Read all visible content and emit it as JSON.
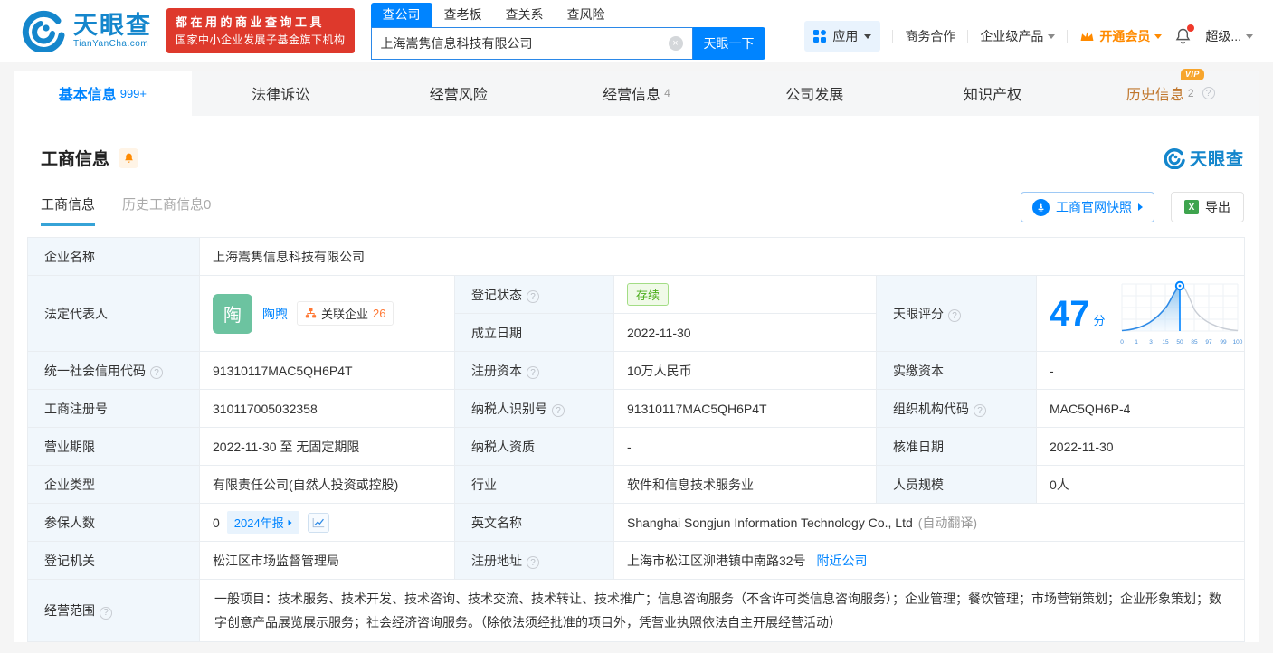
{
  "header": {
    "logo": {
      "name": "天眼查",
      "domain": "TianYanCha.com"
    },
    "slogan": {
      "line1": "都在用的商业查询工具",
      "line2": "国家中小企业发展子基金旗下机构"
    },
    "search": {
      "tabs": {
        "company": "查公司",
        "boss": "查老板",
        "relation": "查关系",
        "risk": "查风险"
      },
      "value": "上海嵩隽信息科技有限公司",
      "submit": "天眼一下"
    },
    "nav": {
      "apps": "应用",
      "cooperation": "商务合作",
      "enterprise": "企业级产品",
      "vip": "开通会员",
      "account": "超级..."
    }
  },
  "tabs": {
    "basic": {
      "label": "基本信息",
      "badge": "999+"
    },
    "legal": {
      "label": "法律诉讼"
    },
    "risk": {
      "label": "经营风险"
    },
    "operation": {
      "label": "经营信息",
      "badge": "4"
    },
    "development": {
      "label": "公司发展"
    },
    "ip": {
      "label": "知识产权"
    },
    "history": {
      "label": "历史信息",
      "badge": "2",
      "vip": "VIP"
    }
  },
  "section": {
    "title": "工商信息",
    "watermark": "天眼查",
    "subtab_current": "工商信息",
    "subtab_history": "历史工商信息0",
    "snapshot_btn": "工商官网快照",
    "export_btn": "导出"
  },
  "table": {
    "company_name": {
      "label": "企业名称",
      "value": "上海嵩隽信息科技有限公司"
    },
    "legal_rep": {
      "label": "法定代表人",
      "avatar": "陶",
      "name": "陶煦",
      "related_label": "关联企业",
      "related_count": "26"
    },
    "reg_status": {
      "label": "登记状态",
      "value": "存续"
    },
    "establish_date": {
      "label": "成立日期",
      "value": "2022-11-30"
    },
    "score": {
      "label": "天眼评分",
      "value": "47",
      "unit": "分"
    },
    "credit_code": {
      "label": "统一社会信用代码",
      "value": "91310117MAC5QH6P4T"
    },
    "reg_capital": {
      "label": "注册资本",
      "value": "10万人民币"
    },
    "paid_capital": {
      "label": "实缴资本",
      "value": "-"
    },
    "reg_number": {
      "label": "工商注册号",
      "value": "310117005032358"
    },
    "taxpayer_id": {
      "label": "纳税人识别号",
      "value": "91310117MAC5QH6P4T"
    },
    "org_code": {
      "label": "组织机构代码",
      "value": "MAC5QH6P-4"
    },
    "business_term": {
      "label": "营业期限",
      "value": "2022-11-30 至 无固定期限"
    },
    "taxpayer_quality": {
      "label": "纳税人资质",
      "value": "-"
    },
    "approval_date": {
      "label": "核准日期",
      "value": "2022-11-30"
    },
    "company_type": {
      "label": "企业类型",
      "value": "有限责任公司(自然人投资或控股)"
    },
    "industry": {
      "label": "行业",
      "value": "软件和信息技术服务业"
    },
    "staff_size": {
      "label": "人员规模",
      "value": "0人"
    },
    "insured": {
      "label": "参保人数",
      "value": "0",
      "report_badge": "2024年报"
    },
    "english_name": {
      "label": "英文名称",
      "value": "Shanghai Songjun Information Technology Co., Ltd",
      "note": "(自动翻译)"
    },
    "reg_authority": {
      "label": "登记机关",
      "value": "松江区市场监督管理局"
    },
    "reg_address": {
      "label": "注册地址",
      "value": "上海市松江区泖港镇中南路32号",
      "link": "附近公司"
    },
    "business_scope": {
      "label": "经营范围",
      "value": "一般项目：技术服务、技术开发、技术咨询、技术交流、技术转让、技术推广；信息咨询服务（不含许可类信息咨询服务）；企业管理；餐饮管理；市场营销策划；企业形象策划；数字创意产品展览展示服务；社会经济咨询服务。（除依法须经批准的项目外，凭营业执照依法自主开展经营活动）"
    }
  },
  "score_chart": {
    "type": "area",
    "description": "天眼评分 score distribution bell curve with marker at company score",
    "ticks": [
      "0",
      "1",
      "3",
      "15",
      "50",
      "85",
      "97",
      "99",
      "100"
    ],
    "marker_value": "47",
    "accent": "#0084ff"
  },
  "colors": {
    "brand_blue": "#0084ff",
    "banner_red": "#de392c",
    "vip_orange": "#ff8a00",
    "status_green": "#4cae1c",
    "label_bg": "#f1f7fc"
  }
}
